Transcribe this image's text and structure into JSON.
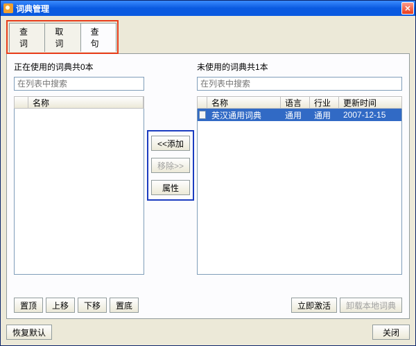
{
  "window": {
    "title": "词典管理"
  },
  "tabs": {
    "check": "查词",
    "fetch": "取词",
    "examine": "查句"
  },
  "left": {
    "title": "正在使用的词典共0本",
    "search_placeholder": "在列表中搜索",
    "header": {
      "name": "名称"
    }
  },
  "right": {
    "title": "未使用的词典共1本",
    "search_placeholder": "在列表中搜索",
    "header": {
      "name": "名称",
      "lang": "语言",
      "ind": "行业",
      "date": "更新时间"
    },
    "rows": [
      {
        "name": "英汉通用词典",
        "lang": "通用",
        "ind": "通用",
        "date": "2007-12-15"
      }
    ]
  },
  "mid": {
    "add": "<<添加",
    "remove": "移除>>",
    "props": "属性"
  },
  "bottom": {
    "top": "置顶",
    "up": "上移",
    "down": "下移",
    "bottomBtn": "置底",
    "activate": "立即激活",
    "uninstall": "卸载本地词典"
  },
  "footer": {
    "restore": "恢复默认",
    "close": "关闭"
  }
}
